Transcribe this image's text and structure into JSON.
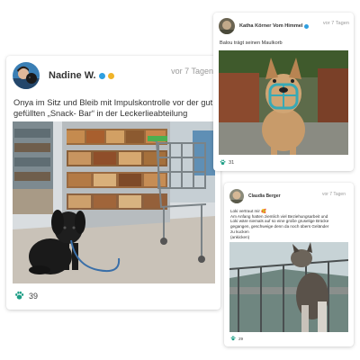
{
  "colors": {
    "accent": "#1e9e86",
    "verified": "#2f9fe0",
    "gold": "#f0b429",
    "time": "#9a9a9a"
  },
  "posts": [
    {
      "author": "Nadine W.",
      "time": "vor 7 Tagen",
      "text": "Onya im Sitz und Bleib mit Impulskontrolle vor der gut gefüllten „Snack- Bar“ in der Leckerlieabteilung",
      "likes": "39",
      "like_icon": "paw-icon",
      "badges": [
        "verified-badge-icon",
        "gold-badge-icon"
      ]
    },
    {
      "author": "Katha Körner Vom Himmel",
      "time": "vor 7 Tagen",
      "text": "Balou trägt seinen Maulkorb",
      "likes": "31",
      "like_icon": "paw-icon",
      "badges": [
        "verified-badge-icon"
      ]
    },
    {
      "author": "Claudia Berger",
      "time": "vor 7 Tagen",
      "text_lines": [
        "Loki vertraut mir 🥰",
        "Am Anfang hatten ziemlich viel Beziehungsarbeit und",
        "Loki wäre niemals auf so eine große gruselige Brücke",
        "gegangen, geschweige denn da noch übers Geländer",
        "zu kucken",
        "(ankicken)"
      ],
      "likes": "29",
      "like_icon": "paw-icon"
    }
  ]
}
